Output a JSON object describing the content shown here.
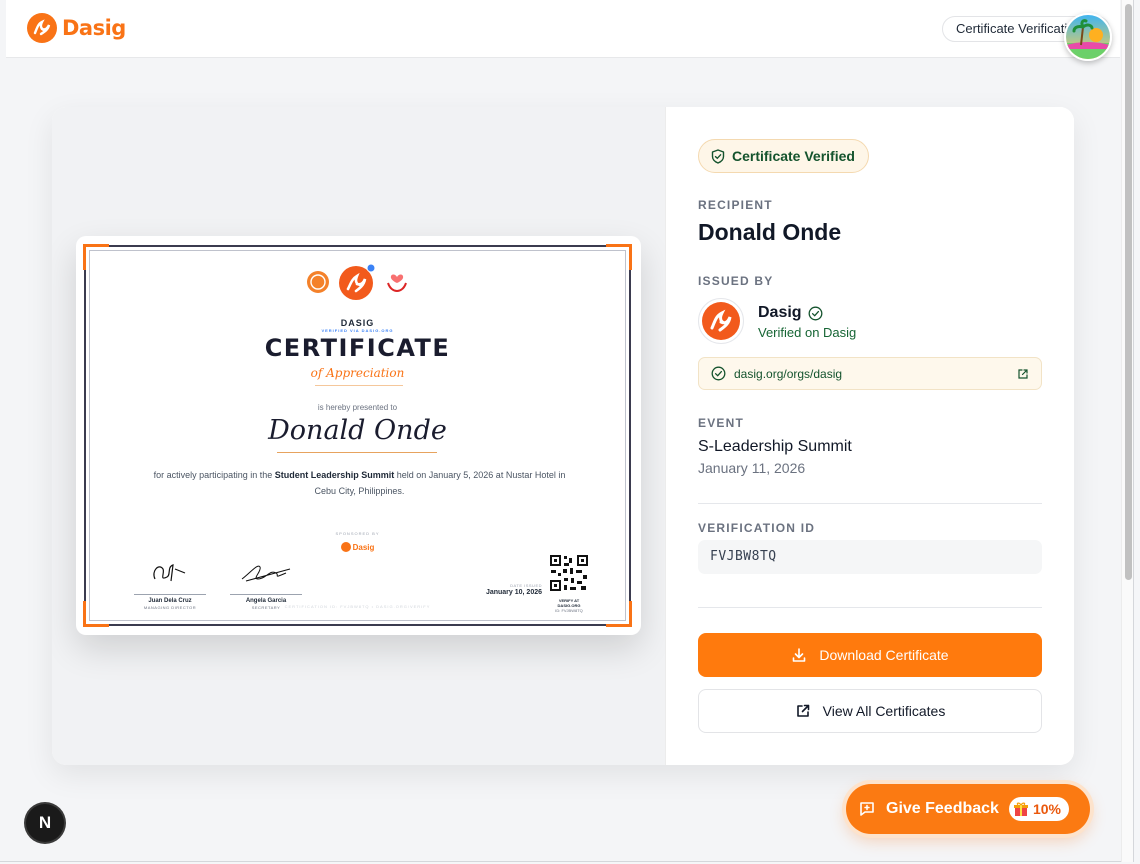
{
  "app": {
    "brand": "Dasig",
    "top_pill": "Certificate Verification"
  },
  "certificate": {
    "org_short": "DASIG",
    "verified_via": "VERIFIED VIA DASIG.ORG",
    "title": "CERTIFICATE",
    "subtitle": "of Appreciation",
    "presented": "is hereby presented to",
    "recipient": "Donald Onde",
    "desc_pre": "for actively participating in the ",
    "desc_event": "Student Leadership Summit",
    "desc_post": " held on January 5, 2026 at Nustar Hotel in Cebu City, Philippines.",
    "sponsored_by": "SPONSORED BY",
    "sponsor": "Dasig",
    "signatories": [
      {
        "name": "Juan Dela Cruz",
        "role": "MANAGING DIRECTOR"
      },
      {
        "name": "Angela Garcia",
        "role": "SECRETARY"
      }
    ],
    "date_label": "DATE ISSUED",
    "date_value": "January 10, 2026",
    "verify_label": "VERIFY AT DASIG.ORG",
    "verify_id": "ID: FVJBW8TQ",
    "footer": "CERTIFICATION ID: FVJBW8TQ • DASIG.ORG/VERIFY"
  },
  "panel": {
    "badge": "Certificate Verified",
    "recipient_label": "RECIPIENT",
    "recipient_name": "Donald Onde",
    "issued_label": "ISSUED BY",
    "org_name": "Dasig",
    "org_verified": "Verified on Dasig",
    "org_link": "dasig.org/orgs/dasig",
    "event_label": "EVENT",
    "event_name": "S-Leadership Summit",
    "event_date": "January 11, 2026",
    "vid_label": "VERIFICATION ID",
    "vid": "FVJBW8TQ",
    "download": "Download Certificate",
    "view_all": "View All Certificates"
  },
  "feedback": {
    "label": "Give Feedback",
    "badge": "10%"
  },
  "next_badge": "N",
  "colors": {
    "accent": "#f97316",
    "verified_green": "#14532d"
  }
}
